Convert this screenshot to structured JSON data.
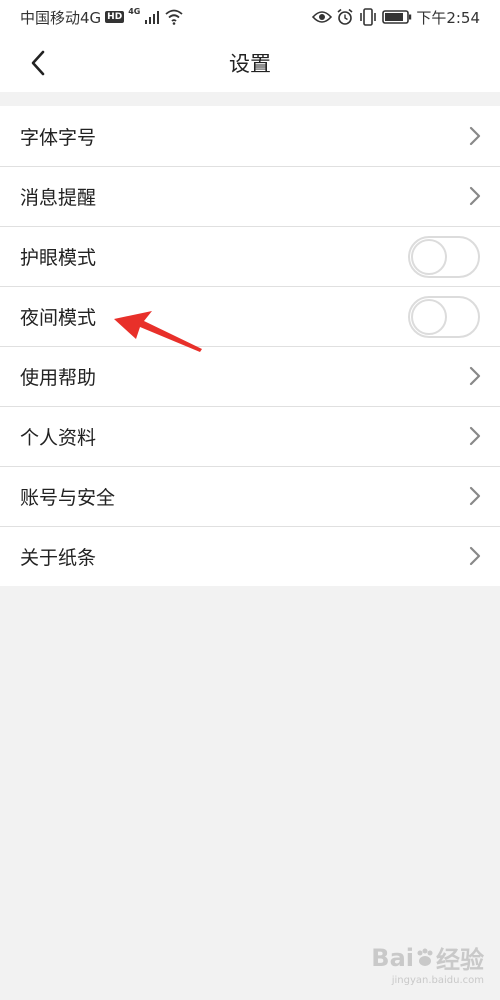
{
  "status_bar": {
    "carrier": "中国移动4G",
    "hd": "HD",
    "network": "4G",
    "time": "下午2:54"
  },
  "header": {
    "title": "设置",
    "back_icon": "chevron-left-icon"
  },
  "settings": {
    "items": [
      {
        "label": "字体字号",
        "control": "chevron"
      },
      {
        "label": "消息提醒",
        "control": "chevron"
      },
      {
        "label": "护眼模式",
        "control": "toggle",
        "on": false
      },
      {
        "label": "夜间模式",
        "control": "toggle",
        "on": false
      },
      {
        "label": "使用帮助",
        "control": "chevron"
      },
      {
        "label": "个人资料",
        "control": "chevron"
      },
      {
        "label": "账号与安全",
        "control": "chevron"
      },
      {
        "label": "关于纸条",
        "control": "chevron"
      }
    ]
  },
  "annotation": {
    "color": "#e8302a",
    "points_to": "夜间模式"
  },
  "watermark": {
    "brand": "Bai",
    "brand_suffix": "经验",
    "url": "jingyan.baidu.com"
  },
  "colors": {
    "background": "#f2f2f2",
    "surface": "#ffffff",
    "divider": "#e0e0e0",
    "chevron": "#888888",
    "toggle_border": "#dcdcdc"
  }
}
